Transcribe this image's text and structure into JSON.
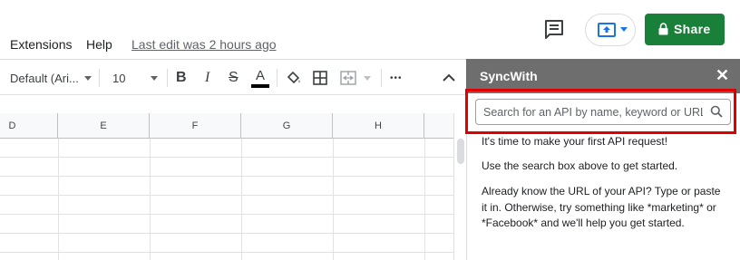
{
  "menubar": {
    "items": [
      "Extensions",
      "Help"
    ],
    "last_edit": "Last edit was 2 hours ago",
    "share_label": "Share"
  },
  "toolbar": {
    "font": "Default (Ari...",
    "font_size": "10",
    "bold": "B",
    "italic": "I",
    "strike": "S",
    "text_color": "A",
    "more": "•••"
  },
  "grid": {
    "columns": [
      "D",
      "E",
      "F",
      "G",
      "H"
    ]
  },
  "sidebar": {
    "title": "SyncWith",
    "close": "✕",
    "search_placeholder": "Search for an API by name, keyword or URL",
    "messages": [
      "It's time to make your first API request!",
      "Use the search box above to get started.",
      "Already know the URL of your API? Type or paste it in. Otherwise, try something like *marketing* or *Facebook* and we'll help you get started."
    ]
  },
  "colors": {
    "share_green": "#188038",
    "sidebar_header": "#6e6e6e",
    "highlight_red": "#e00000",
    "accent_blue": "#1a73e8"
  }
}
